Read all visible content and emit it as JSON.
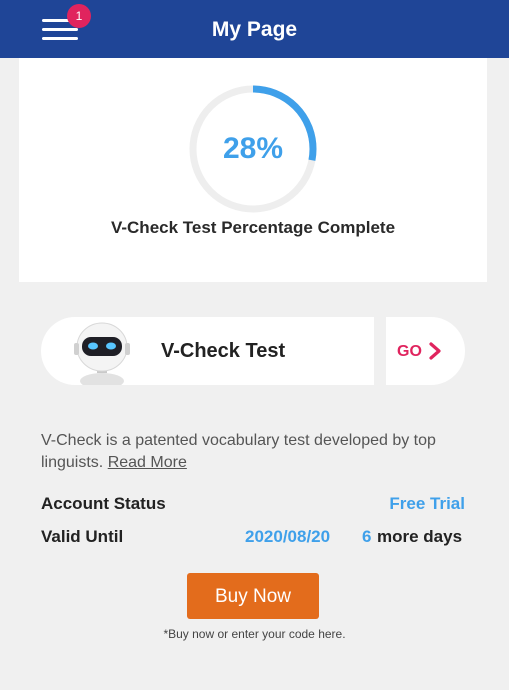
{
  "header": {
    "title": "My Page",
    "menu_icon": "hamburger-menu-icon",
    "notification_count": "1",
    "background": "#1f4597",
    "badge_color": "#e0245e"
  },
  "progress": {
    "percent_text": "28%",
    "value": 0.28,
    "label": "V-Check Test Percentage Complete",
    "ring_color": "#3fa0ea",
    "track_color": "#eeeeee"
  },
  "test_card": {
    "title": "V-Check Test",
    "avatar_icon": "robot-icon",
    "go_label": "GO",
    "go_icon": "chevron-right-icon",
    "go_color": "#e0245e"
  },
  "description": {
    "text": "V-Check is a patented vocabulary test developed by top linguists.",
    "read_more": "Read More"
  },
  "account": {
    "status_label": "Account Status",
    "status_value": "Free Trial",
    "valid_label": "Valid Until",
    "valid_date": "2020/08/20",
    "days_count": "6",
    "days_text": "more days",
    "accent_color": "#3fa0ea"
  },
  "purchase": {
    "button_label": "Buy Now",
    "note": "*Buy now or enter your code here.",
    "button_color": "#e36c1c"
  }
}
